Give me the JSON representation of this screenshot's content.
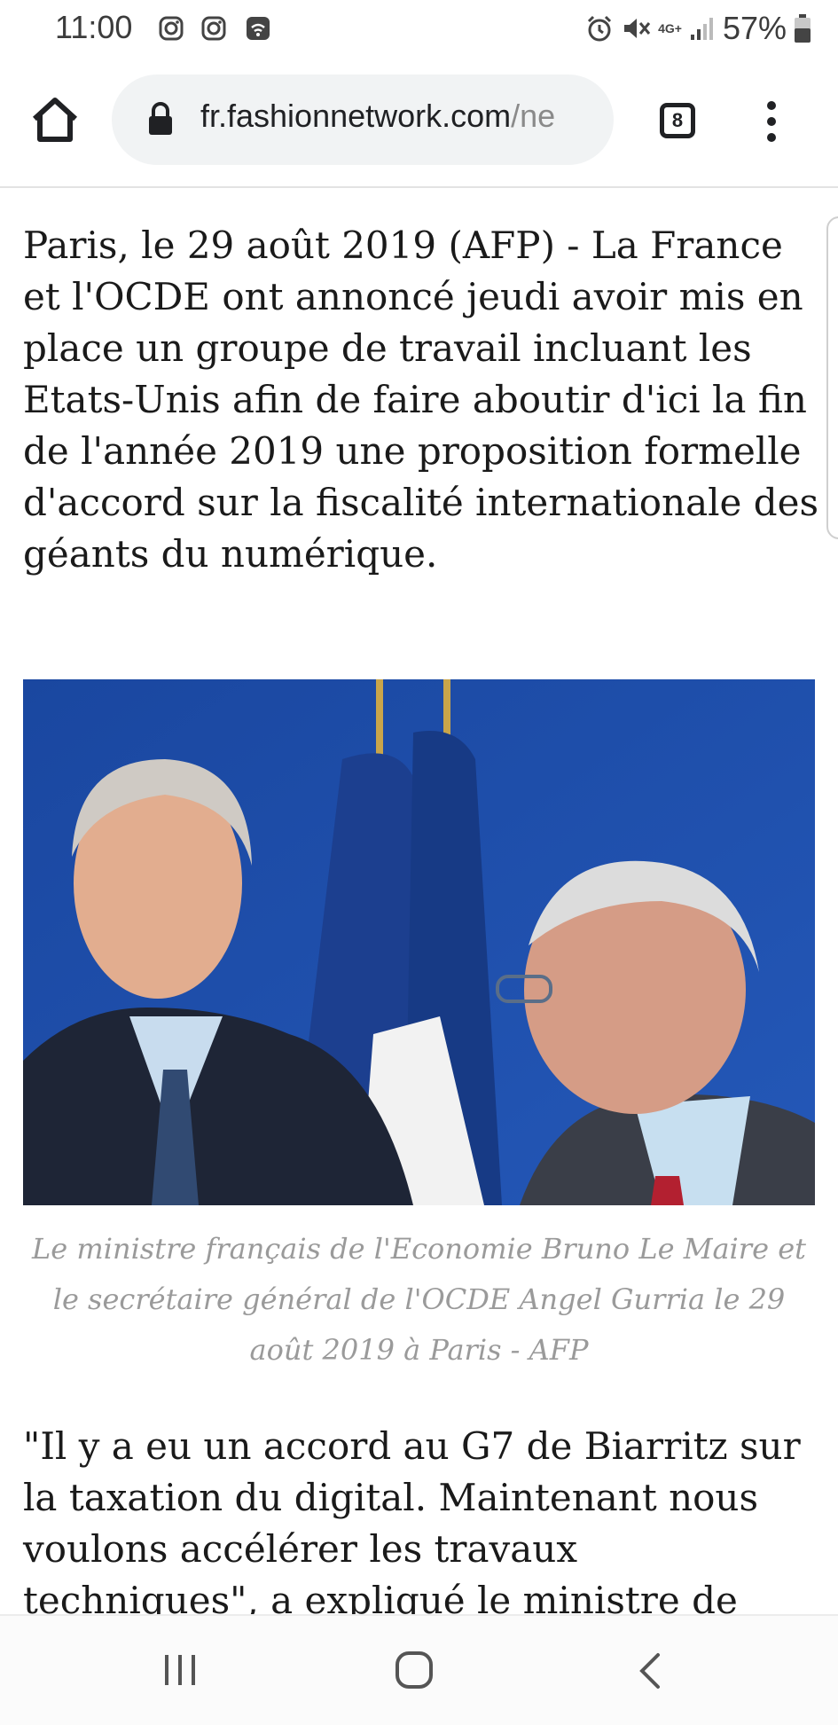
{
  "status_bar": {
    "time": "11:00",
    "network": "4G+",
    "battery": "57%",
    "icons": [
      "instagram-icon",
      "instagram-icon",
      "wifi-icon",
      "alarm-icon",
      "mute-icon",
      "signal-icon",
      "battery-icon"
    ]
  },
  "browser": {
    "url_host": "fr.fashionnetwork.com",
    "url_rest": "/ne",
    "tab_count": "8"
  },
  "article": {
    "paragraph_1": "Paris, le 29 août 2019 (AFP) - La France et l'OCDE ont annoncé jeudi avoir mis en place un groupe de travail incluant les Etats-Unis afin de faire aboutir d'ici la fin de l'année 2019 une proposition formelle d'accord sur la fiscalité internationale des géants du numérique.",
    "photo_caption": "Le ministre français de l'Economie Bruno Le Maire et le secrétaire général de l'OCDE Angel Gurria le 29 août 2019 à Paris - AFP",
    "paragraph_2": "\"Il y a eu un accord au G7 de Biarritz sur la taxation du digital. Maintenant nous voulons accélérer les travaux techniques\", a expliqué le ministre de"
  },
  "colors": {
    "photo_background": "#1d4fa8",
    "caption_text": "#9a9a9a",
    "omnibox": "#f1f3f4"
  }
}
